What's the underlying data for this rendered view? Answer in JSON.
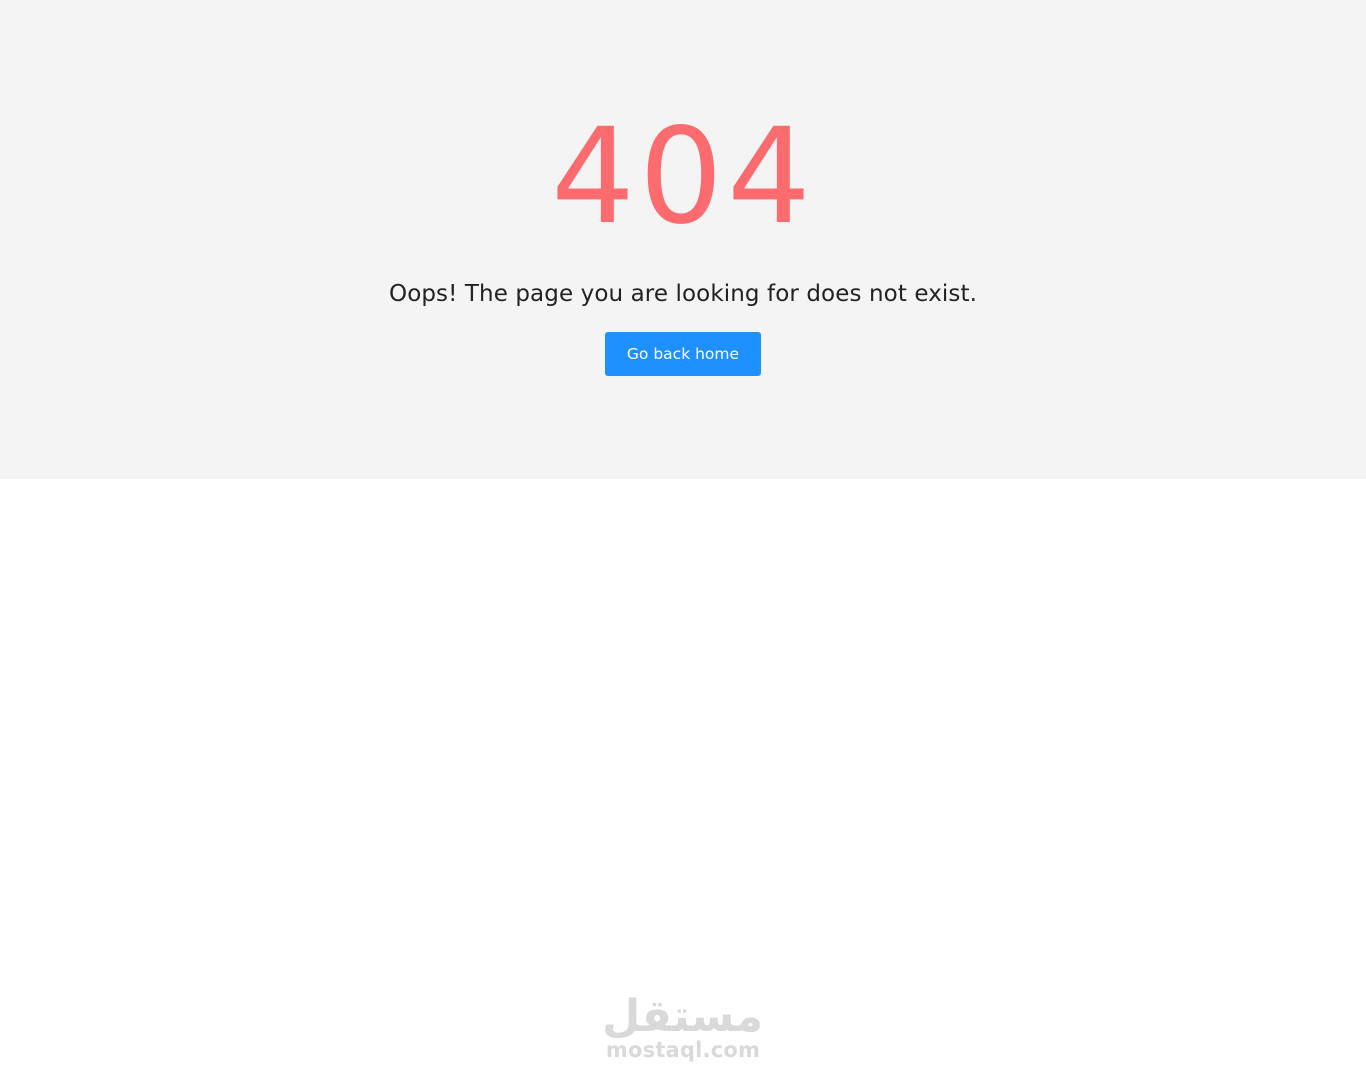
{
  "error": {
    "code": "404",
    "message": "Oops! The page you are looking for does not exist.",
    "button_label": "Go back home"
  },
  "footer": {
    "brand_arabic": "مستقل",
    "brand_latin": "mostaql.com"
  },
  "colors": {
    "hero_background": "#f4f4f4",
    "code_color": "#fc6b6e",
    "button_background": "#1e90ff",
    "logo_color": "#d9d9d9"
  }
}
